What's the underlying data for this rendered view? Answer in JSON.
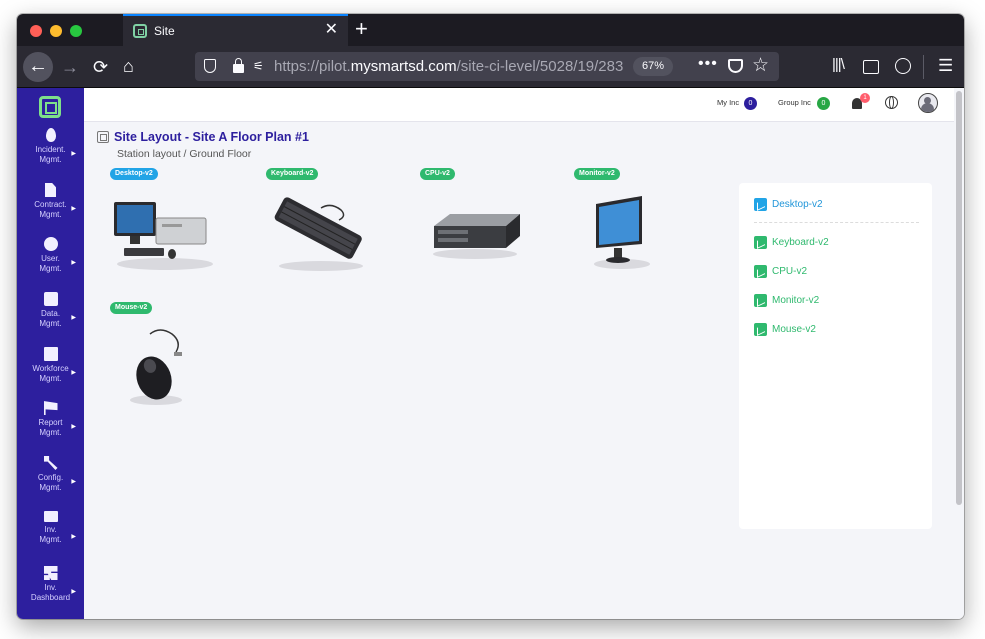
{
  "browser": {
    "tab_title": "Site",
    "tab_close": "✕",
    "new_tab": "+",
    "url_prefix": "https://pilot.",
    "url_domain": "mysmartsd.com",
    "url_path": "/site-ci-level/5028/19/283",
    "zoom": "67%",
    "url_menu": "•••",
    "back_glyph": "←",
    "forward_glyph": "→",
    "reload_glyph": "⟳",
    "home_glyph": "⌂",
    "star_glyph": "☆",
    "library_glyph": "|||\\",
    "menu_glyph": "☰",
    "perm_glyph": "⚟"
  },
  "sidebar": {
    "items": [
      {
        "label1": "Incident.",
        "label2": "Mgmt.",
        "icon": "fire-icon"
      },
      {
        "label1": "Contract.",
        "label2": "Mgmt.",
        "icon": "document-icon"
      },
      {
        "label1": "User.",
        "label2": "Mgmt.",
        "icon": "user-icon"
      },
      {
        "label1": "Data.",
        "label2": "Mgmt.",
        "icon": "puzzle-icon"
      },
      {
        "label1": "Workforce",
        "label2": "Mgmt.",
        "icon": "calendar-icon"
      },
      {
        "label1": "Report",
        "label2": "Mgmt.",
        "icon": "flag-icon"
      },
      {
        "label1": "Config.",
        "label2": "Mgmt.",
        "icon": "wrench-icon"
      },
      {
        "label1": "Inv.",
        "label2": "Mgmt.",
        "icon": "monitor-icon"
      },
      {
        "label1": "Inv.",
        "label2": "Dashboard",
        "icon": "dashboard-icon"
      }
    ]
  },
  "topnav": {
    "my_inc_label": "My Inc",
    "my_inc_count": "0",
    "group_inc_label": "Group Inc",
    "group_inc_count": "0",
    "notifications_count": "1"
  },
  "page": {
    "title": "Site Layout - Site A Floor Plan #1",
    "subtitle": "Station layout / Ground Floor"
  },
  "devices": [
    {
      "tag": "Desktop-v2",
      "color": "#21a4e6"
    },
    {
      "tag": "Keyboard-v2",
      "color": "#2fb96e"
    },
    {
      "tag": "CPU-v2",
      "color": "#2fb96e"
    },
    {
      "tag": "Monitor-v2",
      "color": "#2fb96e"
    },
    {
      "tag": "Mouse-v2",
      "color": "#2fb96e"
    }
  ],
  "ci_list": [
    {
      "label": "Desktop-v2",
      "color": "#2196d9"
    },
    {
      "label": "Keyboard-v2",
      "color": "#2fb96e"
    },
    {
      "label": "CPU-v2",
      "color": "#2fb96e"
    },
    {
      "label": "Monitor-v2",
      "color": "#2fb96e"
    },
    {
      "label": "Mouse-v2",
      "color": "#2fb96e"
    }
  ]
}
